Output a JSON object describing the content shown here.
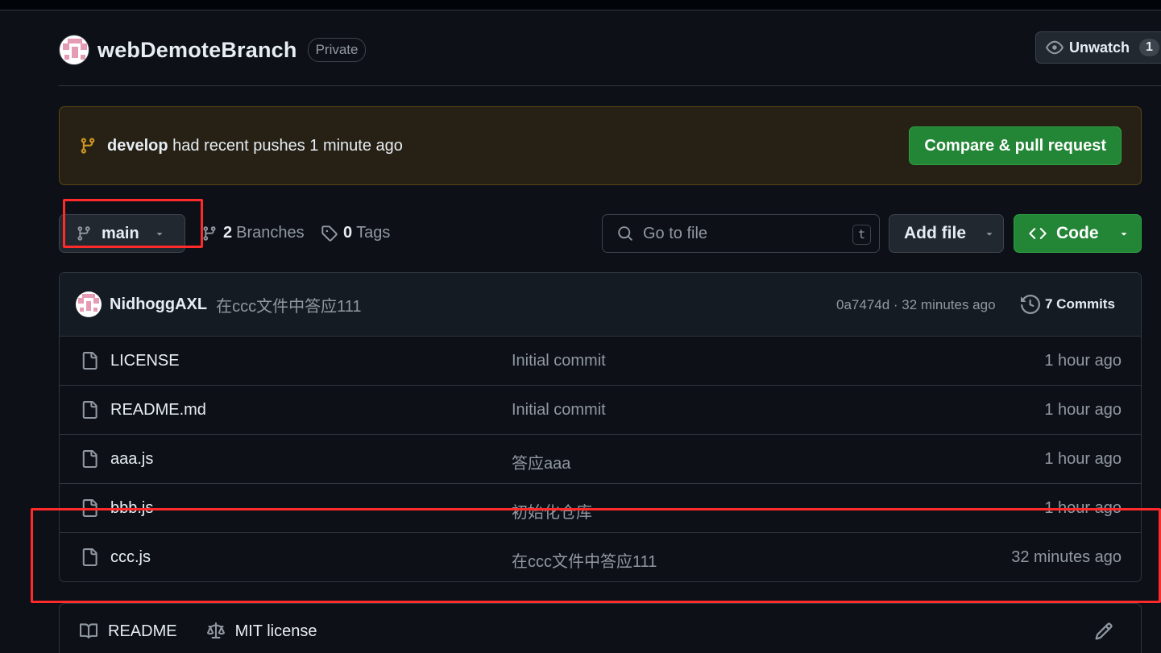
{
  "repo": {
    "name": "webDemoteBranch",
    "visibility": "Private",
    "watch": {
      "label": "Unwatch",
      "count": "1"
    }
  },
  "banner": {
    "branch": "develop",
    "message": "had recent pushes 1 minute ago",
    "button": "Compare & pull request",
    "accent": "#d29922"
  },
  "toolbar": {
    "branch": "main",
    "branches_count": "2",
    "branches_label": "Branches",
    "tags_count": "0",
    "tags_label": "Tags",
    "search_placeholder": "Go to file",
    "search_shortcut": "t",
    "add_file": "Add file",
    "code": "Code"
  },
  "latest_commit": {
    "author": "NidhoggAXL",
    "message": "在ccc文件中答应111",
    "hash_time": "0a7474d · 32 minutes ago",
    "commits_label": "7 Commits"
  },
  "files": [
    {
      "name": "LICENSE",
      "message": "Initial commit",
      "time": "1 hour ago"
    },
    {
      "name": "README.md",
      "message": "Initial commit",
      "time": "1 hour ago"
    },
    {
      "name": "aaa.js",
      "message": "答应aaa",
      "time": "1 hour ago"
    },
    {
      "name": "bbb.js",
      "message": "初始化仓库",
      "time": "1 hour ago"
    },
    {
      "name": "ccc.js",
      "message": "在ccc文件中答应111",
      "time": "32 minutes ago"
    }
  ],
  "readme_tabs": {
    "readme": "README",
    "license": "MIT license"
  },
  "colors": {
    "background": "#0d1117",
    "primary_button": "#238636",
    "annotation": "#ff2a2a"
  }
}
